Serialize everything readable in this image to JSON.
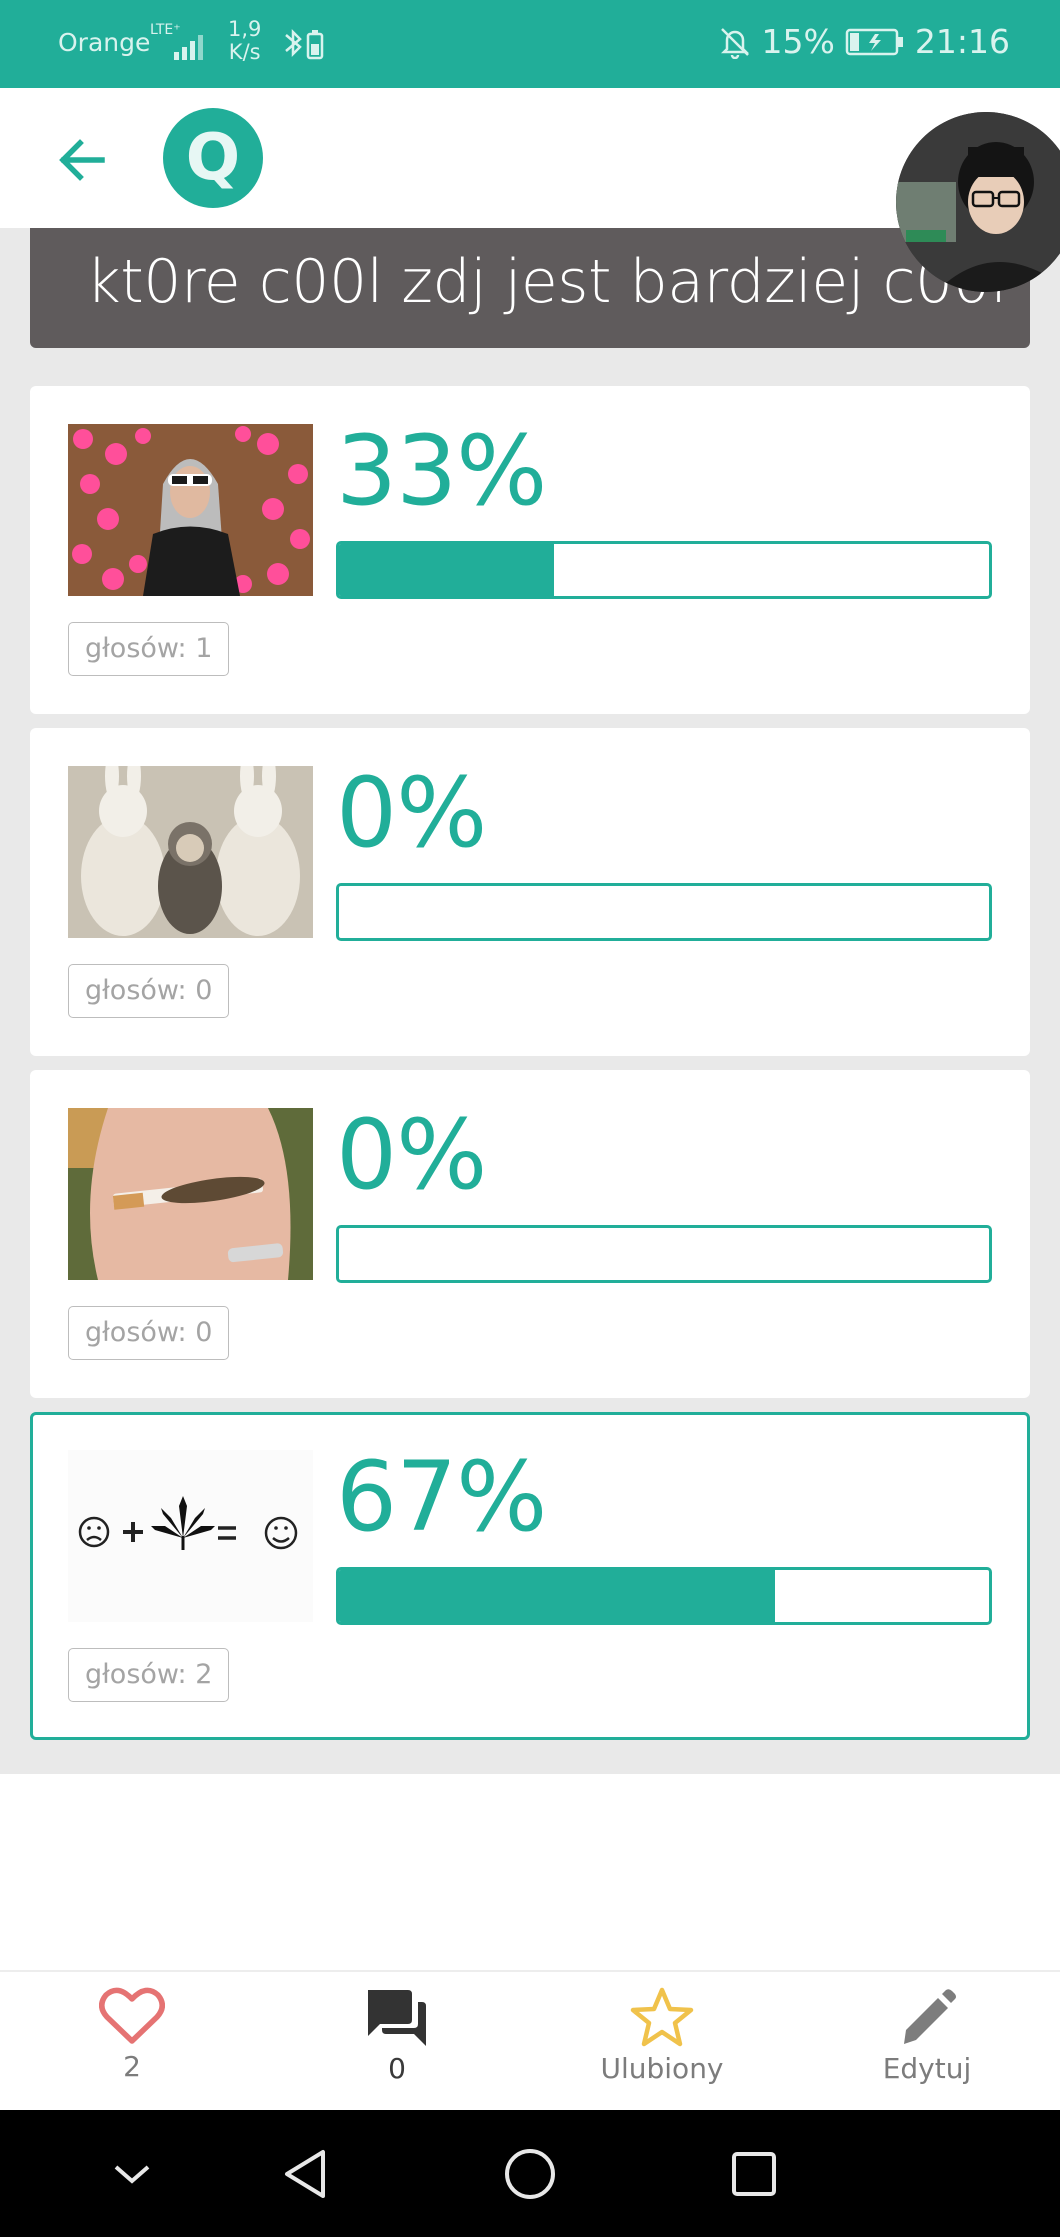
{
  "status_bar": {
    "carrier": "Orange",
    "network": "LTE⁺",
    "speed_value": "1,9",
    "speed_unit": "K/s",
    "battery": "15%",
    "time": "21:16"
  },
  "poll": {
    "title": "kt0re c00l zdj jest bardziej c00l",
    "options": [
      {
        "percent_label": "33%",
        "percent": 33,
        "votes_label": "głosów: 1",
        "selected": false,
        "image": "man-with-hearts-photo"
      },
      {
        "percent_label": "0%",
        "percent": 0,
        "votes_label": "głosów: 0",
        "selected": false,
        "image": "child-with-rabbits-photo"
      },
      {
        "percent_label": "0%",
        "percent": 0,
        "votes_label": "głosów: 0",
        "selected": false,
        "image": "lizard-cigarette-photo"
      },
      {
        "percent_label": "67%",
        "percent": 67,
        "votes_label": "głosów: 2",
        "selected": true,
        "image": "emoji-equation"
      }
    ]
  },
  "actions": {
    "like_count": "2",
    "comment_count": "0",
    "favorite_label": "Ulubiony",
    "edit_label": "Edytuj"
  },
  "colors": {
    "accent": "#21ae99",
    "banner": "#5f5b5c",
    "heart": "#e57373",
    "star": "#f0c24b"
  },
  "icons": [
    "back-arrow-icon",
    "app-logo-icon",
    "heart-icon",
    "comments-icon",
    "star-icon",
    "pencil-icon",
    "nav-down-icon",
    "nav-back-icon",
    "nav-home-icon",
    "nav-recents-icon"
  ]
}
